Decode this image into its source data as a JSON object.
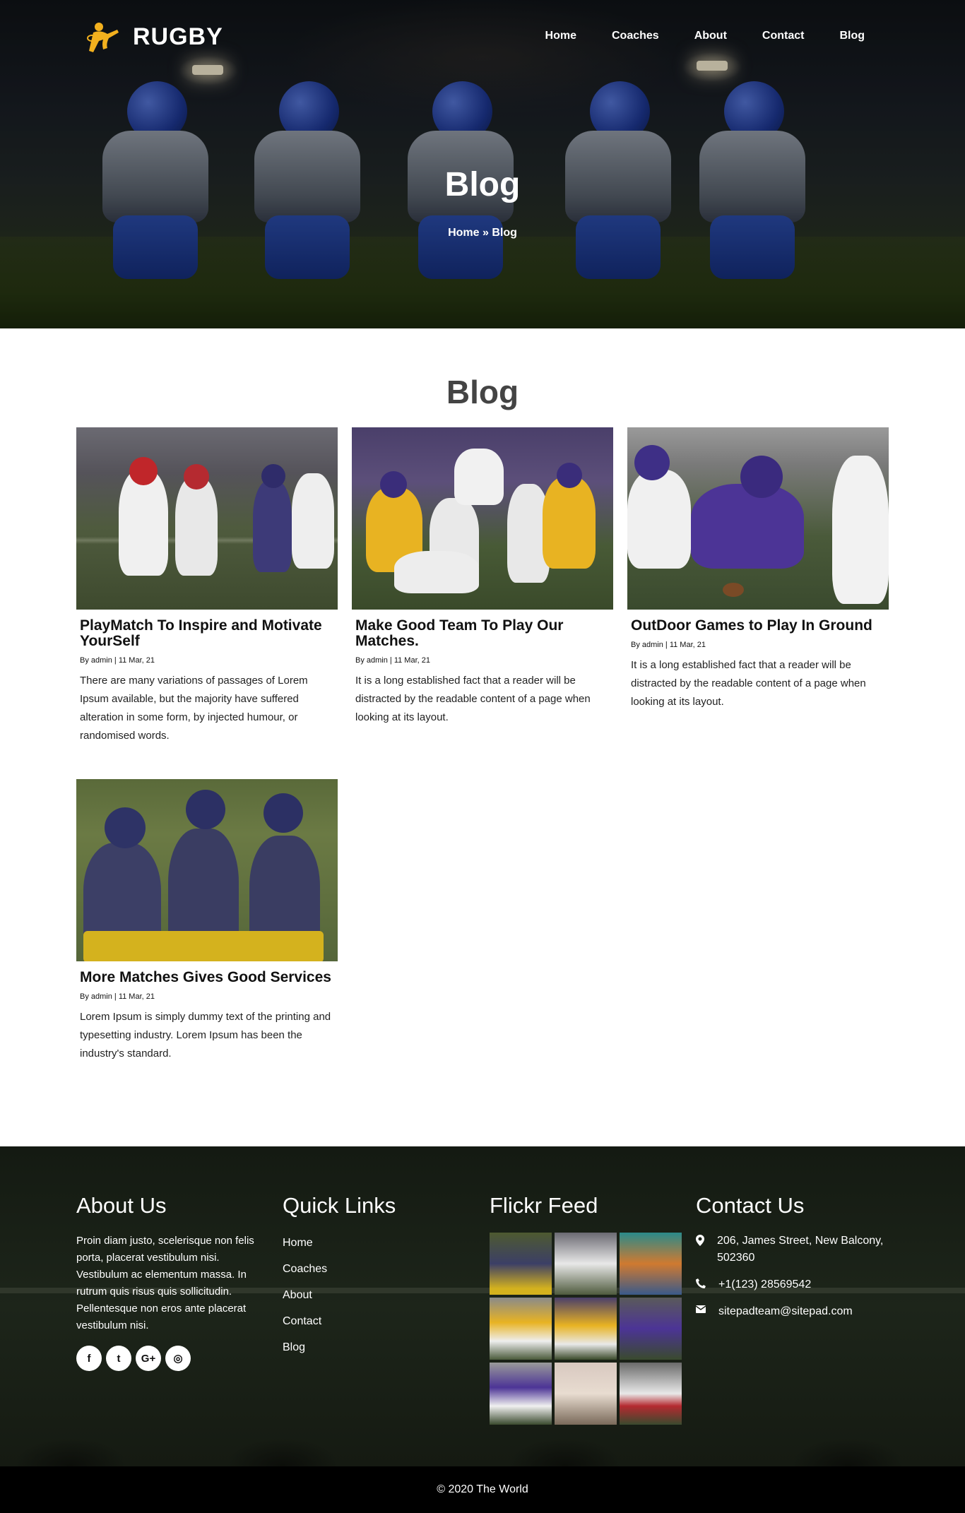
{
  "brand": {
    "name": "RUGBY"
  },
  "nav": {
    "items": [
      {
        "label": "Home"
      },
      {
        "label": "Coaches"
      },
      {
        "label": "About"
      },
      {
        "label": "Contact"
      },
      {
        "label": "Blog"
      }
    ]
  },
  "hero": {
    "title": "Blog",
    "breadcrumb": "Home » Blog"
  },
  "blog": {
    "heading": "Blog",
    "posts": [
      {
        "title": "PlayMatch To Inspire and Motivate YourSelf",
        "meta": "By admin | 11 Mar, 21",
        "excerpt": "There are many variations of passages of Lorem Ipsum available, but the majority have suffered alteration in some form, by injected humour, or randomised words."
      },
      {
        "title": "Make Good Team To Play Our Matches.",
        "meta": "By admin | 11 Mar, 21",
        "excerpt": "It is a long established fact that a reader will be distracted by the readable content of a page when looking at its layout."
      },
      {
        "title": "OutDoor Games to Play In Ground",
        "meta": "By admin | 11 Mar, 21",
        "excerpt": "It is a long established fact that a reader will be distracted by the readable content of a page when looking at its layout."
      },
      {
        "title": "More Matches Gives Good Services",
        "meta": "By admin | 11 Mar, 21",
        "excerpt": "Lorem Ipsum is simply dummy text of the printing and typesetting industry. Lorem Ipsum has been the industry's standard."
      }
    ]
  },
  "footer": {
    "about": {
      "heading": "About Us",
      "text": "Proin diam justo, scelerisque non felis porta, placerat vestibulum nisi. Vestibulum ac elementum massa. In rutrum quis risus quis sollicitudin. Pellentesque non eros ante placerat vestibulum nisi.",
      "social": [
        {
          "icon": "facebook-icon",
          "glyph": "f"
        },
        {
          "icon": "twitter-icon",
          "glyph": "t"
        },
        {
          "icon": "google-plus-icon",
          "glyph": "G+"
        },
        {
          "icon": "instagram-icon",
          "glyph": "◎"
        }
      ]
    },
    "quick_links": {
      "heading": "Quick Links",
      "items": [
        {
          "label": "Home"
        },
        {
          "label": "Coaches"
        },
        {
          "label": "About"
        },
        {
          "label": "Contact"
        },
        {
          "label": "Blog"
        }
      ]
    },
    "flickr": {
      "heading": "Flickr Feed"
    },
    "contact": {
      "heading": "Contact Us",
      "address": "206, James Street, New Balcony, 502360",
      "phone": "+1(123) 28569542",
      "email": "sitepadteam@sitepad.com"
    },
    "copyright": "© 2020 The World"
  },
  "colors": {
    "accent": "#f2b01e",
    "heading_gray": "#444444",
    "footer_bg": "#1a2016",
    "copyright_bg": "#000000"
  }
}
